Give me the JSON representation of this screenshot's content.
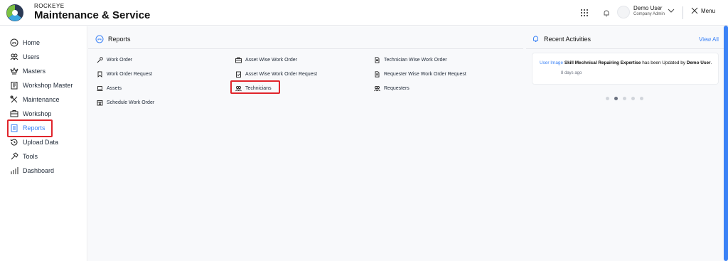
{
  "brand": {
    "small": "ROCKEYE",
    "title": "Maintenance & Service"
  },
  "header": {
    "user_name": "Demo User",
    "user_role": "Company Admin",
    "menu_label": "Menu"
  },
  "sidebar": {
    "items": [
      {
        "label": "Home",
        "icon": "home-icon"
      },
      {
        "label": "Users",
        "icon": "users-icon"
      },
      {
        "label": "Masters",
        "icon": "crown-icon"
      },
      {
        "label": "Workshop Master",
        "icon": "clipboard-icon"
      },
      {
        "label": "Maintenance",
        "icon": "tools-cross-icon"
      },
      {
        "label": "Workshop",
        "icon": "briefcase-icon"
      },
      {
        "label": "Reports",
        "icon": "report-icon",
        "active": true
      },
      {
        "label": "Upload Data",
        "icon": "history-icon"
      },
      {
        "label": "Tools",
        "icon": "hammer-icon"
      },
      {
        "label": "Dashboard",
        "icon": "chart-icon"
      }
    ]
  },
  "reports": {
    "title": "Reports",
    "col1": [
      "Work Order",
      "Work Order Request",
      "Assets",
      "Schedule Work Order"
    ],
    "col2": [
      "Asset Wise Work Order",
      "Asset Wise Work Order Request",
      "Technicians"
    ],
    "col3": [
      "Technician Wise Work Order",
      "Requester Wise Work Order Request",
      "Requesters"
    ]
  },
  "activities": {
    "title": "Recent Activities",
    "view_all": "View All",
    "item": {
      "img_alt": "User Image",
      "bold1": "Skill Mechnical Repairing Expertise",
      "middle": " has been Updated by ",
      "bold2": "Demo User",
      "end": ".",
      "time": "8 days ago"
    }
  },
  "colors": {
    "accent": "#3b82f6",
    "highlight": "#e0242b"
  }
}
